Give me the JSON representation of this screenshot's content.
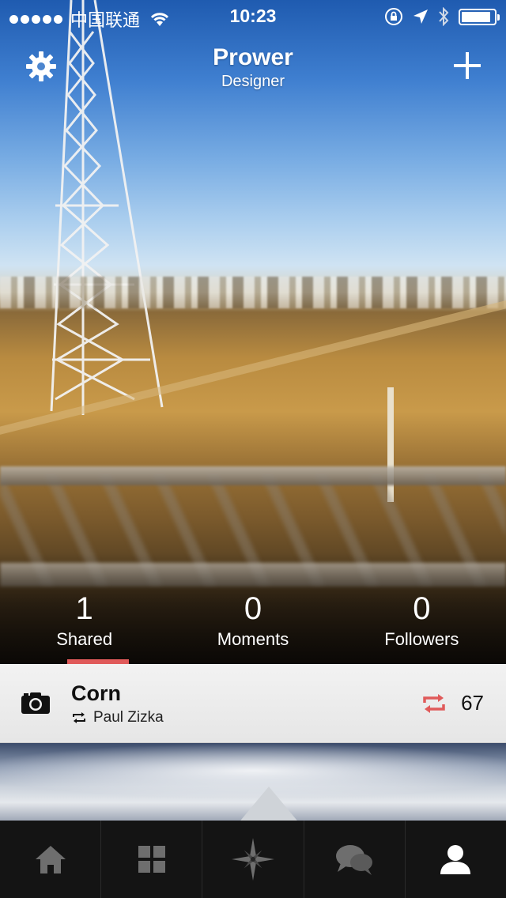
{
  "status_bar": {
    "carrier": "中国联通",
    "time": "10:23"
  },
  "header": {
    "title": "Prower",
    "subtitle": "Designer"
  },
  "stats": [
    {
      "value": "1",
      "label": "Shared",
      "selected": true
    },
    {
      "value": "0",
      "label": "Moments",
      "selected": false
    },
    {
      "value": "0",
      "label": "Followers",
      "selected": false
    }
  ],
  "post": {
    "title": "Corn",
    "author": "Paul Zizka",
    "repost_count": "67"
  },
  "colors": {
    "accent": "#e05a5a",
    "tabbar_bg": "#141414",
    "tab_active_bg": "#262626",
    "tab_icon": "#6e6e6e",
    "tab_icon_active": "#ffffff"
  },
  "icons": {
    "settings": "gear-icon",
    "add": "plus-icon",
    "post_type": "camera-icon",
    "repost_small": "repost-icon",
    "repost_count": "repost-icon",
    "tabs": [
      "home-icon",
      "grid-icon",
      "compass-star-icon",
      "chat-bubbles-icon",
      "user-icon"
    ]
  },
  "tabbar": {
    "active_index": 4
  }
}
